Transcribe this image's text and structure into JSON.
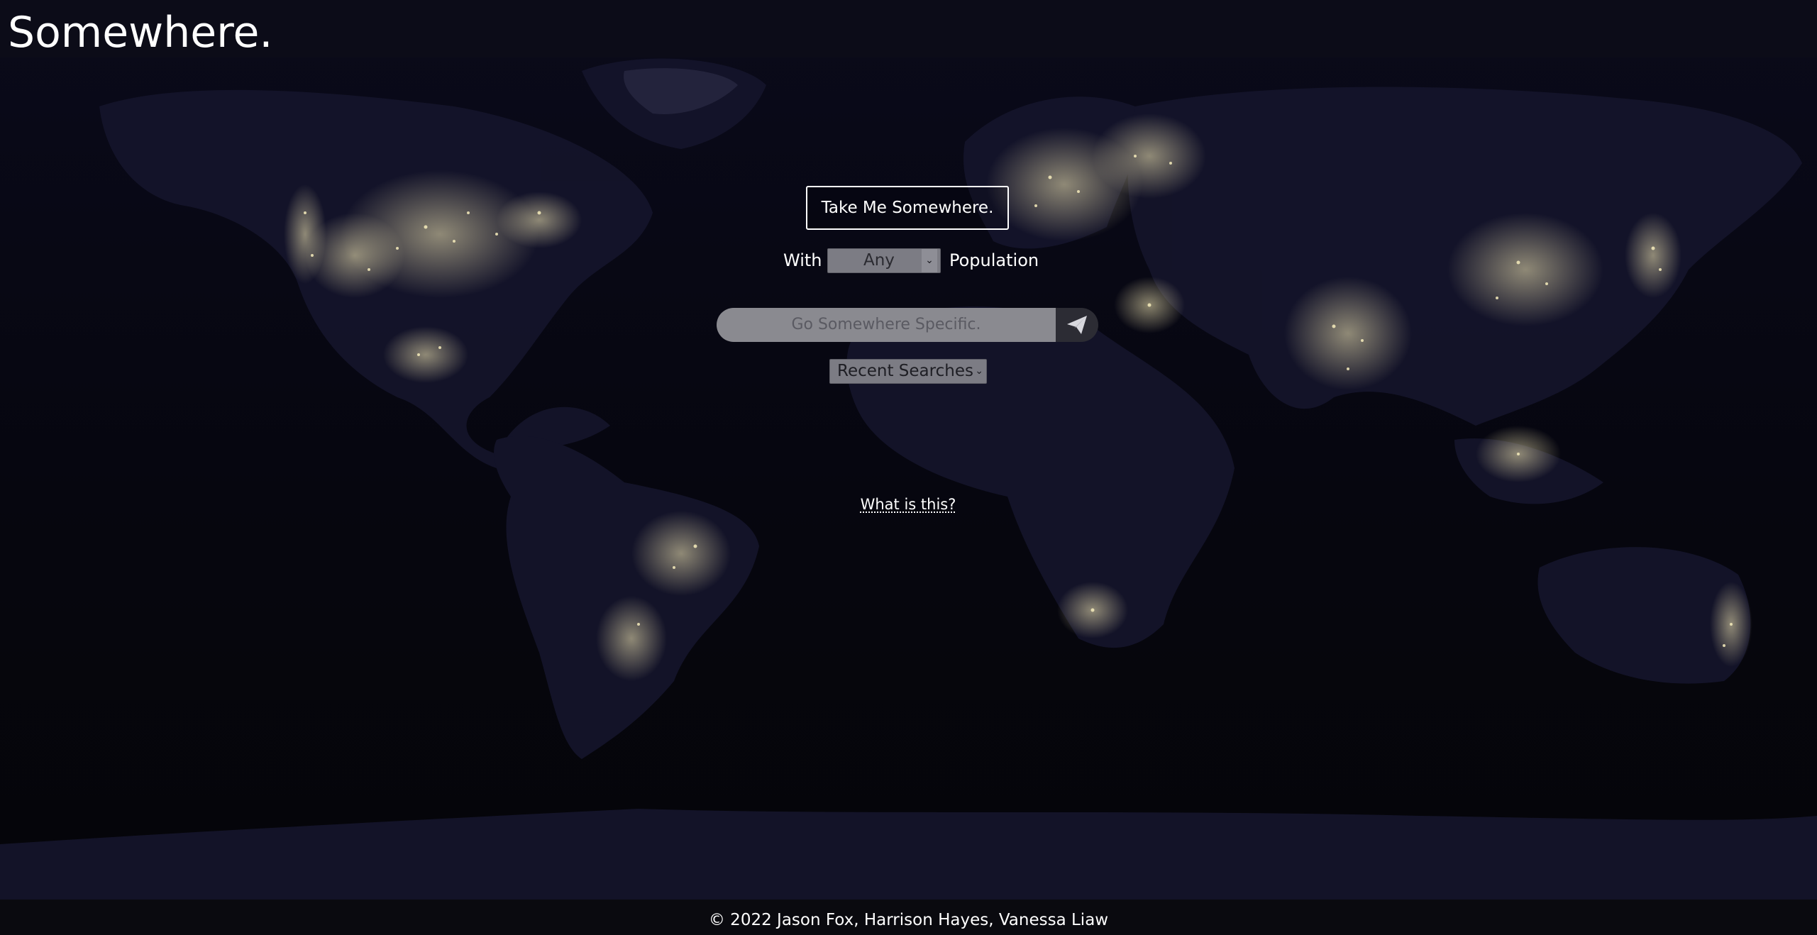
{
  "header": {
    "title": "Somewhere."
  },
  "controls": {
    "random_button_label": "Take Me Somewhere.",
    "with_label": "With",
    "population_selected": "Any",
    "population_label": "Population",
    "search_placeholder": "Go Somewhere Specific.",
    "send_icon": "paper-plane-icon",
    "recent_searches_selected": "Recent Searches",
    "about_link": "What is this?"
  },
  "footer": {
    "copyright": "© 2022 Jason Fox, Harrison Hayes, Vanessa Liaw"
  },
  "colors": {
    "background": "#06060e",
    "city_lights": "#f2e7b0",
    "land": "#15152a",
    "ice": "#2b2b45",
    "text": "#ffffff"
  }
}
